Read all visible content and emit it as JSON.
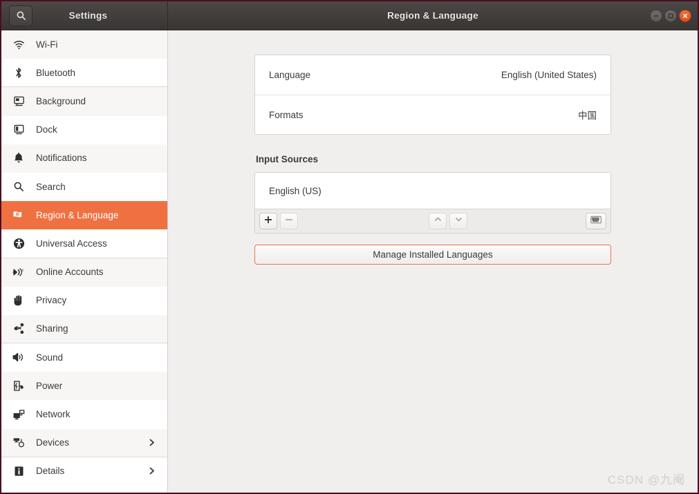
{
  "window": {
    "sidebar_title": "Settings",
    "title": "Region & Language",
    "search_icon": "search-icon",
    "controls": {
      "minimize": "minimize-icon",
      "maximize": "maximize-icon",
      "close": "close-icon"
    },
    "border_color": "#4a0d22",
    "titlebar_color": "#413e3c",
    "close_color": "#e2501b"
  },
  "sidebar": {
    "accent_color": "#ef7142",
    "items": [
      {
        "label": "Wi-Fi",
        "icon": "wifi-icon",
        "selected": false,
        "chevron": false,
        "separator": false
      },
      {
        "label": "Bluetooth",
        "icon": "bluetooth-icon",
        "selected": false,
        "chevron": false,
        "separator": true
      },
      {
        "label": "Background",
        "icon": "background-icon",
        "selected": false,
        "chevron": false,
        "separator": false
      },
      {
        "label": "Dock",
        "icon": "dock-icon",
        "selected": false,
        "chevron": false,
        "separator": false
      },
      {
        "label": "Notifications",
        "icon": "bell-icon",
        "selected": false,
        "chevron": false,
        "separator": false
      },
      {
        "label": "Search",
        "icon": "search-icon",
        "selected": false,
        "chevron": false,
        "separator": false
      },
      {
        "label": "Region & Language",
        "icon": "region-language-icon",
        "selected": true,
        "chevron": false,
        "separator": false
      },
      {
        "label": "Universal Access",
        "icon": "accessibility-icon",
        "selected": false,
        "chevron": false,
        "separator": true
      },
      {
        "label": "Online Accounts",
        "icon": "online-accounts-icon",
        "selected": false,
        "chevron": false,
        "separator": false
      },
      {
        "label": "Privacy",
        "icon": "privacy-hand-icon",
        "selected": false,
        "chevron": false,
        "separator": false
      },
      {
        "label": "Sharing",
        "icon": "sharing-icon",
        "selected": false,
        "chevron": false,
        "separator": true
      },
      {
        "label": "Sound",
        "icon": "sound-icon",
        "selected": false,
        "chevron": false,
        "separator": false
      },
      {
        "label": "Power",
        "icon": "power-icon",
        "selected": false,
        "chevron": false,
        "separator": false
      },
      {
        "label": "Network",
        "icon": "network-icon",
        "selected": false,
        "chevron": false,
        "separator": false
      },
      {
        "label": "Devices",
        "icon": "devices-icon",
        "selected": false,
        "chevron": true,
        "separator": true
      },
      {
        "label": "Details",
        "icon": "details-info-icon",
        "selected": false,
        "chevron": true,
        "separator": false
      }
    ]
  },
  "main": {
    "settings_rows": [
      {
        "label": "Language",
        "value": "English (United States)"
      },
      {
        "label": "Formats",
        "value": "中国"
      }
    ],
    "input_sources": {
      "section_title": "Input Sources",
      "items": [
        {
          "label": "English (US)"
        }
      ],
      "toolbar": {
        "add": "+",
        "remove": "−",
        "move_up": "chevron-up-icon",
        "move_down": "chevron-down-icon",
        "preview": "keyboard-icon"
      }
    },
    "manage_button": "Manage Installed Languages"
  },
  "watermark": "CSDN @九阉"
}
